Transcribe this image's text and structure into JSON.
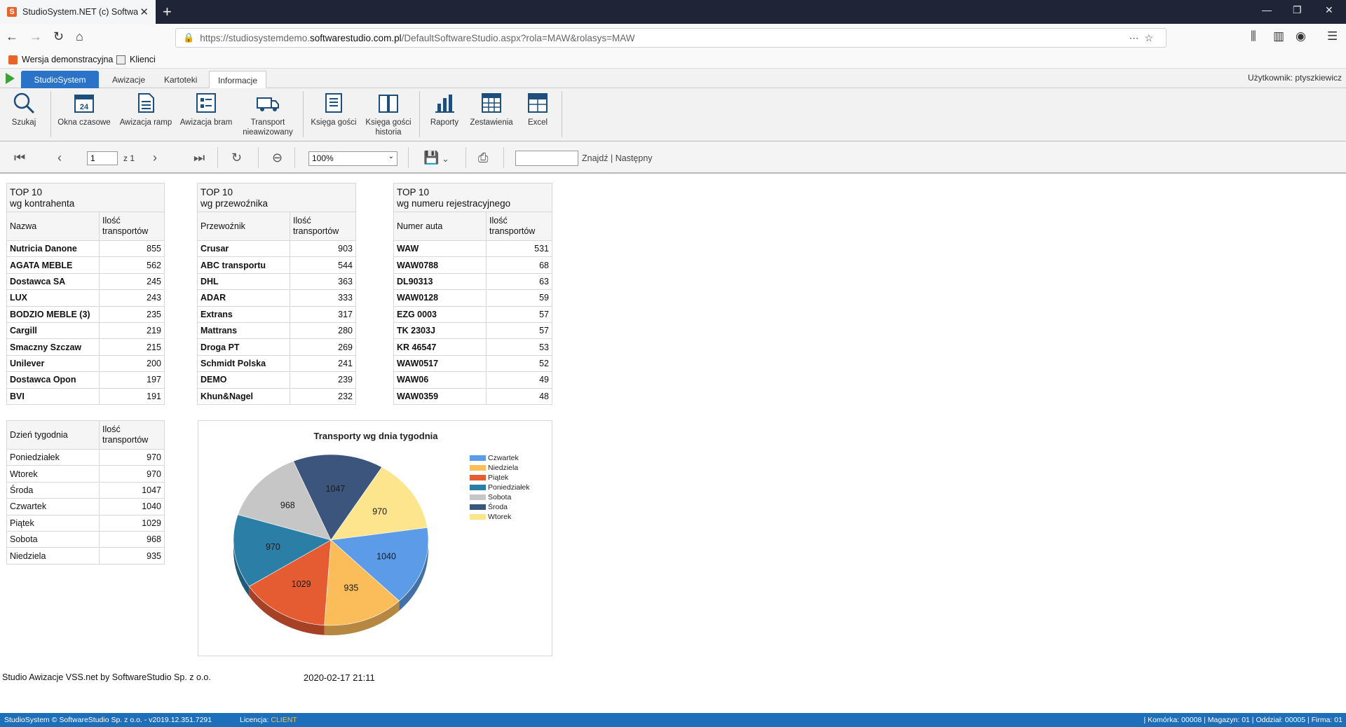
{
  "browser": {
    "tab_title": "StudioSystem.NET (c) Software",
    "url_prefix": "https://studiosystemdemo.",
    "url_host": "softwarestudio.com.pl",
    "url_path": "/DefaultSoftwareStudio.aspx?rola=MAW&rolasys=MAW",
    "bookmarks": [
      "Wersja demonstracyjna",
      "Klienci"
    ]
  },
  "app": {
    "tabs": [
      "StudioSystem",
      "Awizacje",
      "Kartoteki",
      "Informacje"
    ],
    "active_tab": "Informacje",
    "user_label": "Użytkownik: ptyszkiewicz"
  },
  "ribbon": [
    {
      "label": "Szukaj",
      "icon": "search-icon"
    },
    {
      "label": "Okna czasowe",
      "icon": "calendar-icon"
    },
    {
      "label": "Awizacja ramp",
      "icon": "document-icon"
    },
    {
      "label": "Awizacja bram",
      "icon": "gate-icon"
    },
    {
      "label": "Transport\nnieawizowany",
      "icon": "truck-icon"
    },
    {
      "label": "Księga gości",
      "icon": "book-icon"
    },
    {
      "label": "Księga gości\nhistoria",
      "icon": "open-book-icon"
    },
    {
      "label": "Raporty",
      "icon": "bar-chart-icon"
    },
    {
      "label": "Zestawienia",
      "icon": "spreadsheet-icon"
    },
    {
      "label": "Excel",
      "icon": "excel-icon"
    }
  ],
  "report_toolbar": {
    "page_value": "1",
    "page_of": "z 1",
    "zoom": "100%",
    "find_label": "Znajdź | Następny"
  },
  "tables": {
    "kontrahent": {
      "title_line1": "TOP 10",
      "title_line2": "wg kontrahenta",
      "col1": "Nazwa",
      "col2": "Ilość\ntransportów",
      "rows": [
        [
          "Nutricia Danone",
          "855"
        ],
        [
          "AGATA MEBLE",
          "562"
        ],
        [
          "Dostawca SA",
          "245"
        ],
        [
          "LUX",
          "243"
        ],
        [
          "BODZIO MEBLE (3)",
          "235"
        ],
        [
          "Cargill",
          "219"
        ],
        [
          "Smaczny Szczaw",
          "215"
        ],
        [
          "Unilever",
          "200"
        ],
        [
          "Dostawca Opon",
          "197"
        ],
        [
          "BVI",
          "191"
        ]
      ]
    },
    "przewoznik": {
      "title_line1": "TOP 10",
      "title_line2": "wg przewoźnika",
      "col1": "Przewoźnik",
      "col2": "Ilość\ntransportów",
      "rows": [
        [
          "Crusar",
          "903"
        ],
        [
          "ABC transportu",
          "544"
        ],
        [
          "DHL",
          "363"
        ],
        [
          "ADAR",
          "333"
        ],
        [
          "Extrans",
          "317"
        ],
        [
          "Mattrans",
          "280"
        ],
        [
          "Droga PT",
          "269"
        ],
        [
          "Schmidt Polska",
          "241"
        ],
        [
          "DEMO",
          "239"
        ],
        [
          "Khun&Nagel",
          "232"
        ]
      ]
    },
    "rejestracja": {
      "title_line1": "TOP 10",
      "title_line2": "wg numeru rejestracyjnego",
      "col1": "Numer auta",
      "col2": "Ilość\ntransportów",
      "rows": [
        [
          "WAW",
          "531"
        ],
        [
          "WAW0788",
          "68"
        ],
        [
          "DL90313",
          "63"
        ],
        [
          "WAW0128",
          "59"
        ],
        [
          "EZG 0003",
          "57"
        ],
        [
          "TK 2303J",
          "57"
        ],
        [
          "KR 46547",
          "53"
        ],
        [
          "WAW0517",
          "52"
        ],
        [
          "WAW06",
          "49"
        ],
        [
          "WAW0359",
          "48"
        ]
      ]
    },
    "dzien": {
      "col1": "Dzień tygodnia",
      "col2": "Ilość\ntransportów",
      "rows": [
        [
          "Poniedziałek",
          "970"
        ],
        [
          "Wtorek",
          "970"
        ],
        [
          "Środa",
          "1047"
        ],
        [
          "Czwartek",
          "1040"
        ],
        [
          "Piątek",
          "1029"
        ],
        [
          "Sobota",
          "968"
        ],
        [
          "Niedziela",
          "935"
        ]
      ]
    }
  },
  "chart_data": {
    "type": "pie",
    "title": "Transporty wg dnia tygodnia",
    "legend_position": "right",
    "legend": [
      "Czwartek",
      "Niedziela",
      "Piątek",
      "Poniedziałek",
      "Sobota",
      "Środa",
      "Wtorek"
    ],
    "slices": [
      {
        "name": "Wtorek",
        "value": 970,
        "color": "#fde58d"
      },
      {
        "name": "Czwartek",
        "value": 1040,
        "color": "#5b9be8"
      },
      {
        "name": "Niedziela",
        "value": 935,
        "color": "#fbbc5a"
      },
      {
        "name": "Piątek",
        "value": 1029,
        "color": "#e55c33"
      },
      {
        "name": "Poniedziałek",
        "value": 970,
        "color": "#2b7fa6"
      },
      {
        "name": "Sobota",
        "value": 968,
        "color": "#c6c6c6"
      },
      {
        "name": "Środa",
        "value": 1047,
        "color": "#3b557c"
      }
    ]
  },
  "footer": {
    "left": "Studio Awizacje VSS.net by SoftwareStudio Sp. z o.o.",
    "date": "2020-02-17 21:11"
  },
  "statusbar": {
    "left": "StudioSystem © SoftwareStudio Sp. z o.o. - v2019.12.351.7291",
    "license_label": "Licencja:",
    "license_value": "CLIENT",
    "right": "| Komórka: 00008 | Magazyn: 01 | Oddział: 00005 | Firma: 01"
  },
  "colors": {
    "brand_blue": "#2b73c6",
    "status_blue": "#1e6fb9",
    "license_orange": "#f3c34b"
  }
}
